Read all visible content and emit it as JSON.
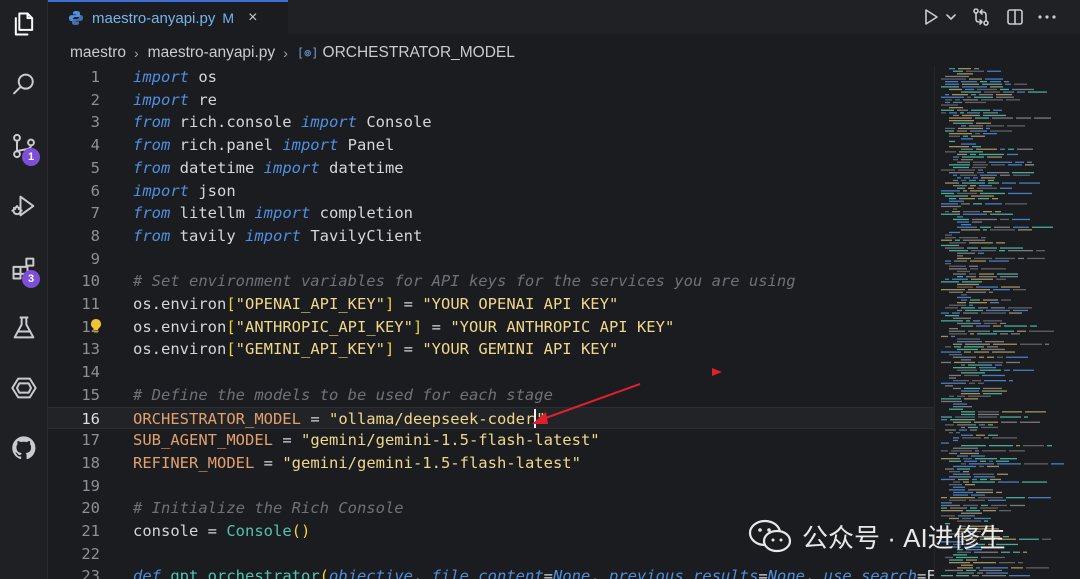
{
  "tab": {
    "filename": "maestro-anyapi.py",
    "modified_marker": "M",
    "close_glyph": "×"
  },
  "breadcrumb": {
    "folder": "maestro",
    "file": "maestro-anyapi.py",
    "symbol_icon": "[⊚]",
    "symbol": "ORCHESTRATOR_MODEL",
    "separator": "›"
  },
  "activity_bar": {
    "items": [
      {
        "name": "explorer-icon"
      },
      {
        "name": "search-icon"
      },
      {
        "name": "source-control-icon",
        "badge": "1"
      },
      {
        "name": "run-debug-icon"
      },
      {
        "name": "extensions-icon",
        "badge": "3"
      },
      {
        "name": "testing-flask-icon"
      },
      {
        "name": "remote-explorer-icon"
      },
      {
        "name": "github-icon"
      }
    ]
  },
  "toolbar": [
    "run-icon",
    "dropdown-chevron-icon",
    "compare-changes-icon",
    "split-editor-icon",
    "more-actions-icon"
  ],
  "editor": {
    "current_line": 16,
    "lines": [
      {
        "n": "1",
        "tokens": [
          [
            "kw",
            "import"
          ],
          [
            "",
            " os"
          ]
        ]
      },
      {
        "n": "2",
        "tokens": [
          [
            "kw",
            "import"
          ],
          [
            "",
            " re"
          ]
        ]
      },
      {
        "n": "3",
        "tokens": [
          [
            "kw",
            "from"
          ],
          [
            "",
            " rich.console "
          ],
          [
            "kw",
            "import"
          ],
          [
            "",
            " Console"
          ]
        ]
      },
      {
        "n": "4",
        "tokens": [
          [
            "kw",
            "from"
          ],
          [
            "",
            " rich.panel "
          ],
          [
            "kw",
            "import"
          ],
          [
            "",
            " Panel"
          ]
        ]
      },
      {
        "n": "5",
        "tokens": [
          [
            "kw",
            "from"
          ],
          [
            "",
            " datetime "
          ],
          [
            "kw",
            "import"
          ],
          [
            "",
            " datetime"
          ]
        ]
      },
      {
        "n": "6",
        "tokens": [
          [
            "kw",
            "import"
          ],
          [
            "",
            " json"
          ]
        ]
      },
      {
        "n": "7",
        "tokens": [
          [
            "kw",
            "from"
          ],
          [
            "",
            " litellm "
          ],
          [
            "kw",
            "import"
          ],
          [
            "",
            " completion"
          ]
        ]
      },
      {
        "n": "8",
        "tokens": [
          [
            "kw",
            "from"
          ],
          [
            "",
            " tavily "
          ],
          [
            "kw",
            "import"
          ],
          [
            "",
            " TavilyClient"
          ]
        ]
      },
      {
        "n": "9",
        "tokens": []
      },
      {
        "n": "10",
        "tokens": [
          [
            "cmt",
            "# Set environment variables for API keys for the services you are using"
          ]
        ]
      },
      {
        "n": "11",
        "tokens": [
          [
            "",
            "os.environ"
          ],
          [
            "brk",
            "["
          ],
          [
            "str",
            "\"OPENAI_API_KEY\""
          ],
          [
            "brk",
            "]"
          ],
          [
            "",
            " = "
          ],
          [
            "str",
            "\"YOUR OPENAI API KEY\""
          ]
        ]
      },
      {
        "n": "12",
        "tokens": [
          [
            "",
            "os.environ"
          ],
          [
            "brk",
            "["
          ],
          [
            "str",
            "\"ANTHROPIC_API_KEY\""
          ],
          [
            "brk",
            "]"
          ],
          [
            "",
            " = "
          ],
          [
            "str",
            "\"YOUR ANTHROPIC API KEY\""
          ]
        ]
      },
      {
        "n": "13",
        "tokens": [
          [
            "",
            "os.environ"
          ],
          [
            "brk",
            "["
          ],
          [
            "str",
            "\"GEMINI_API_KEY\""
          ],
          [
            "brk",
            "]"
          ],
          [
            "",
            " = "
          ],
          [
            "str",
            "\"YOUR GEMINI API KEY\""
          ]
        ]
      },
      {
        "n": "14",
        "tokens": []
      },
      {
        "n": "15",
        "tokens": [
          [
            "cmt",
            "# Define the models to be used for each stage"
          ]
        ]
      },
      {
        "n": "16",
        "tokens": [
          [
            "const",
            "ORCHESTRATOR_MODEL"
          ],
          [
            "",
            " = "
          ],
          [
            "str",
            "\"ollama/deepseek-coder"
          ],
          [
            "cursor",
            ""
          ],
          [
            "str",
            "\""
          ]
        ]
      },
      {
        "n": "17",
        "tokens": [
          [
            "const",
            "SUB_AGENT_MODEL"
          ],
          [
            "",
            " = "
          ],
          [
            "str",
            "\"gemini/gemini-1.5-flash-latest\""
          ]
        ]
      },
      {
        "n": "18",
        "tokens": [
          [
            "const",
            "REFINER_MODEL"
          ],
          [
            "",
            " = "
          ],
          [
            "str",
            "\"gemini/gemini-1.5-flash-latest\""
          ]
        ]
      },
      {
        "n": "19",
        "tokens": []
      },
      {
        "n": "20",
        "tokens": [
          [
            "cmt",
            "# Initialize the Rich Console"
          ]
        ]
      },
      {
        "n": "21",
        "tokens": [
          [
            "",
            "console = "
          ],
          [
            "cls",
            "Console"
          ],
          [
            "brk",
            "()"
          ]
        ]
      },
      {
        "n": "22",
        "tokens": []
      },
      {
        "n": "23",
        "tokens": [
          [
            "kw",
            "def"
          ],
          [
            "",
            " "
          ],
          [
            "fn",
            "gpt_orchestrator"
          ],
          [
            "brk",
            "("
          ],
          [
            "kw",
            "objective"
          ],
          [
            "",
            ", "
          ],
          [
            "kw",
            "file_content"
          ],
          [
            "",
            "="
          ],
          [
            "kw",
            "None"
          ],
          [
            "",
            ", "
          ],
          [
            "kw",
            "previous_results"
          ],
          [
            "",
            "="
          ],
          [
            "kw",
            "None"
          ],
          [
            "",
            ", "
          ],
          [
            "kw",
            "use_search"
          ],
          [
            "",
            "=Fal"
          ]
        ]
      }
    ]
  },
  "colors": {
    "accent": "#3a6fd8",
    "badge": "#7d4fd6",
    "annotation_arrow": "#e0202b"
  },
  "watermark": {
    "text": "公众号 · AI进修生"
  }
}
